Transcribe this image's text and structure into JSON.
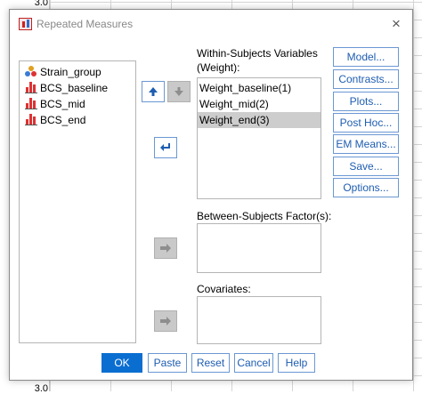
{
  "spreadsheet": {
    "top_value": "3.0",
    "bottom_value": "3.0"
  },
  "dialog": {
    "title": "Repeated Measures",
    "close_glyph": "×"
  },
  "source_variables": [
    {
      "label": "Strain_group",
      "icon": "nominal-variable-icon"
    },
    {
      "label": "BCS_baseline",
      "icon": "scale-variable-icon"
    },
    {
      "label": "BCS_mid",
      "icon": "scale-variable-icon"
    },
    {
      "label": "BCS_end",
      "icon": "scale-variable-icon"
    }
  ],
  "within": {
    "label_line1": "Within-Subjects Variables",
    "label_line2": "(Weight):",
    "items": [
      "Weight_baseline(1)",
      "Weight_mid(2)",
      "Weight_end(3)"
    ],
    "selected_index": 2
  },
  "between": {
    "label": "Between-Subjects Factor(s):"
  },
  "covariates": {
    "label": "Covariates:"
  },
  "side_buttons": [
    "Model...",
    "Contrasts...",
    "Plots...",
    "Post Hoc...",
    "EM Means...",
    "Save...",
    "Options..."
  ],
  "bottom_buttons": [
    "OK",
    "Paste",
    "Reset",
    "Cancel",
    "Help"
  ],
  "colors": {
    "accent": "#0a6ed1",
    "link_text": "#1e5db1",
    "border": "#6b98d3",
    "selected_row": "#cdcdcd"
  }
}
